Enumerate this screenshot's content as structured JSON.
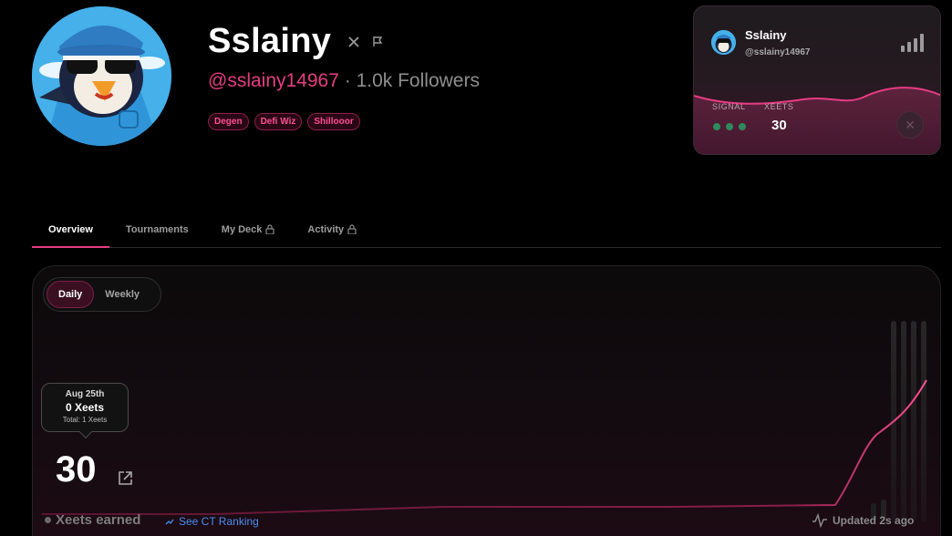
{
  "profile": {
    "name": "Sslainy",
    "handle": "@sslainy14967",
    "followers": "· 1.0k Followers",
    "badges": [
      "Degen",
      "Defi Wiz",
      "Shillooor"
    ]
  },
  "card": {
    "name": "Sslainy",
    "handle": "@sslainy14967",
    "signal_label": "SIGNAL",
    "xeets_label": "XEETS",
    "xeets_value": "30",
    "signal_dots": 3
  },
  "tabs": [
    {
      "label": "Overview",
      "active": true,
      "locked": false
    },
    {
      "label": "Tournaments",
      "active": false,
      "locked": false
    },
    {
      "label": "My Deck",
      "active": false,
      "locked": true
    },
    {
      "label": "Activity",
      "active": false,
      "locked": true
    }
  ],
  "toggle": {
    "daily": "Daily",
    "weekly": "Weekly",
    "selected": "Daily"
  },
  "tooltip": {
    "date": "Aug 25th",
    "value": "0 Xeets",
    "total": "Total: 1 Xeets"
  },
  "stats": {
    "total": "30",
    "label": "Xeets earned",
    "ranking_link": "See CT Ranking",
    "updated": "Updated 2s ago"
  },
  "colors": {
    "accent": "#e63c82",
    "link": "#4a8cf0",
    "signal": "#2f8a5b"
  },
  "icons": {
    "x": "x-logo-icon",
    "report": "flag-icon",
    "lock": "lock-icon",
    "external": "external-link-icon",
    "trend": "trend-icon",
    "pulse": "pulse-icon",
    "signal": "signal-bars-icon"
  }
}
